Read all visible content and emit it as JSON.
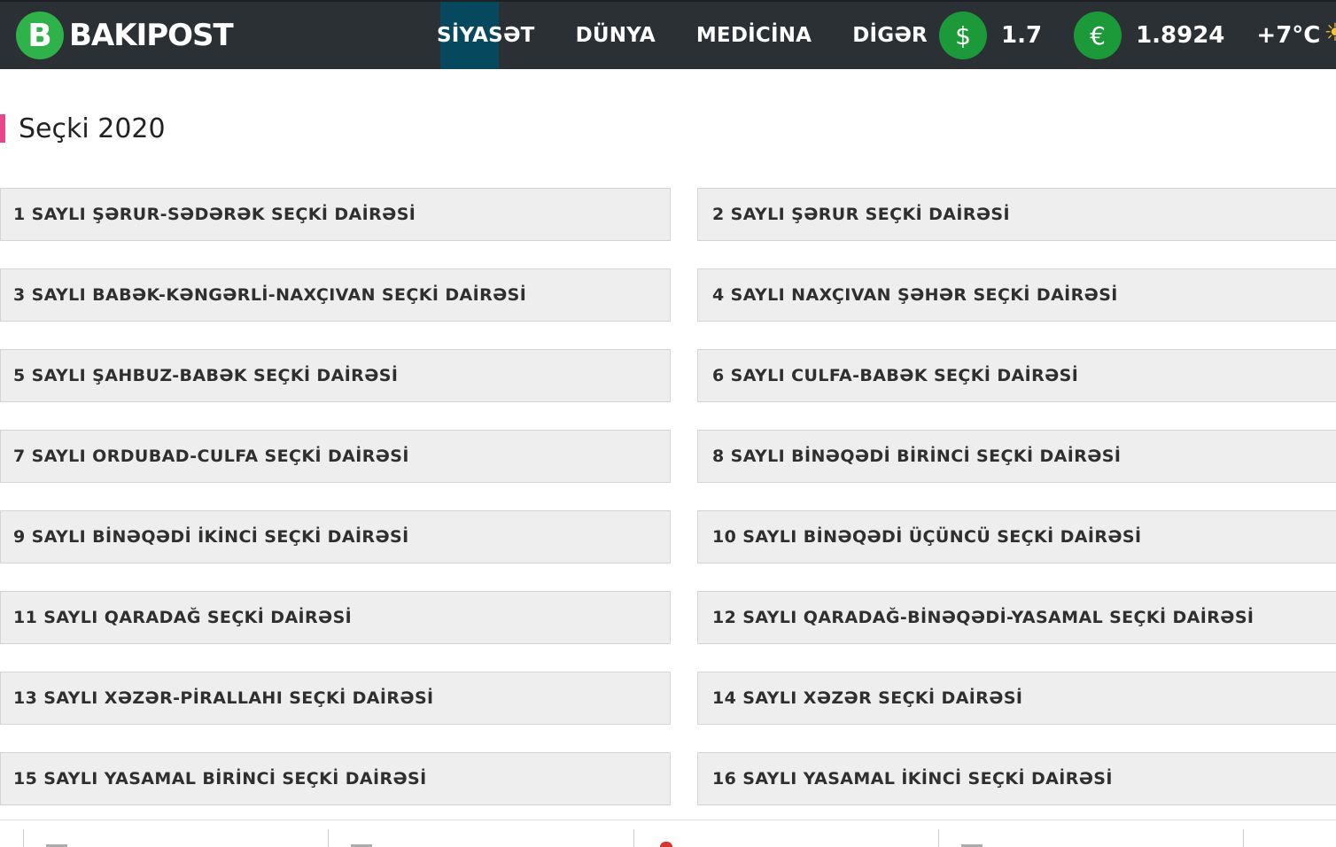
{
  "header": {
    "logo_letter": "B",
    "logo_text": "BAKIPOST",
    "nav": [
      {
        "label": "SİYASƏT",
        "active": true
      },
      {
        "label": "DÜNYA",
        "active": false
      },
      {
        "label": "MEDİCİNA",
        "active": false
      },
      {
        "label": "DİGƏR",
        "active": false
      }
    ],
    "usd": {
      "symbol": "$",
      "value": "1.7"
    },
    "eur": {
      "symbol": "€",
      "value": "1.8924"
    },
    "weather": {
      "temp": "+7°C",
      "icon": "sun-icon",
      "glyph": "☀"
    },
    "colors": {
      "bar": "#2b3034",
      "active_nav": "#06495f",
      "logo": "#2fb24a",
      "currency": "#1c9a3a"
    }
  },
  "section": {
    "title": "Seçki 2020",
    "accent": "#e8478e"
  },
  "districts": [
    "1 SAYLI ŞƏRUR-SƏDƏRƏK SEÇKİ DAİRƏSİ",
    "2 SAYLI ŞƏRUR SEÇKİ DAİRƏSİ",
    "3 SAYLI BABƏK-KƏNGƏRLİ-NAXÇIVAN SEÇKİ DAİRƏSİ",
    "4 SAYLI NAXÇIVAN ŞƏHƏR SEÇKİ DAİRƏSİ",
    "5 SAYLI ŞAHBUZ-BABƏK SEÇKİ DAİRƏSİ",
    "6 SAYLI CULFA-BABƏK SEÇKİ DAİRƏSİ",
    "7 SAYLI ORDUBAD-CULFA SEÇKİ DAİRƏSİ",
    "8 SAYLI BİNƏQƏDİ BİRİNCİ SEÇKİ DAİRƏSİ",
    "9 SAYLI BİNƏQƏDİ İKİNCİ SEÇKİ DAİRƏSİ",
    "10 SAYLI BİNƏQƏDİ ÜÇÜNCÜ SEÇKİ DAİRƏSİ",
    "11 SAYLI QARADAĞ SEÇKİ DAİRƏSİ",
    "12 SAYLI QARADAĞ-BİNƏQƏDİ-YASAMAL SEÇKİ DAİRƏSİ",
    "13 SAYLI XƏZƏR-PİRALLAHI SEÇKİ DAİRƏSİ",
    "14 SAYLI XƏZƏR SEÇKİ DAİRƏSİ",
    "15 SAYLI YASAMAL BİRİNCİ SEÇKİ DAİRƏSİ",
    "16 SAYLI YASAMAL İKİNCİ SEÇKİ DAİRƏSİ"
  ]
}
